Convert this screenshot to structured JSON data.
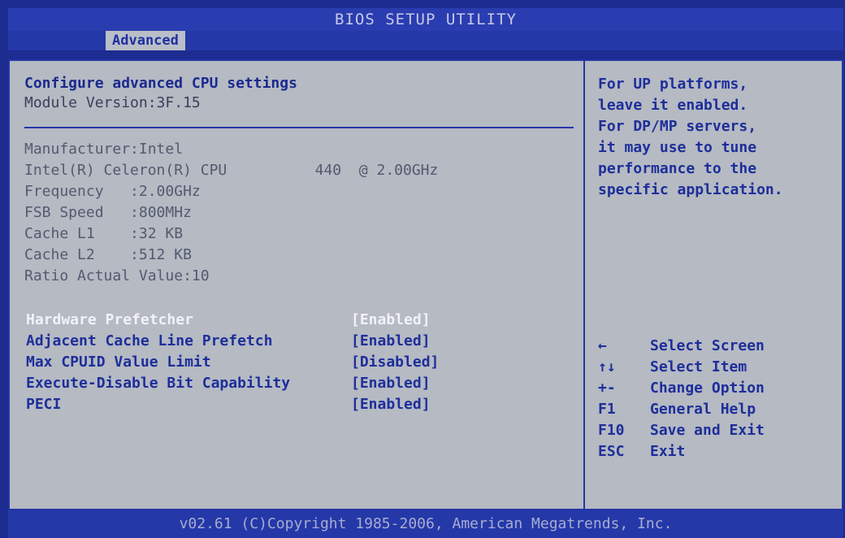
{
  "window": {
    "title": "BIOS SETUP UTILITY"
  },
  "tabs": [
    {
      "label": "Advanced"
    }
  ],
  "main": {
    "heading": "Configure advanced CPU settings",
    "module_version": "Module Version:3F.15",
    "info": [
      "Manufacturer:Intel",
      "Intel(R) Celeron(R) CPU          440  @ 2.00GHz",
      "Frequency   :2.00GHz",
      "FSB Speed   :800MHz",
      "Cache L1    :32 KB",
      "Cache L2    :512 KB",
      "Ratio Actual Value:10"
    ],
    "settings": [
      {
        "name": "Hardware Prefetcher",
        "value": "[Enabled]"
      },
      {
        "name": "Adjacent Cache Line Prefetch",
        "value": "[Enabled]"
      },
      {
        "name": "Max CPUID Value Limit",
        "value": "[Disabled]"
      },
      {
        "name": "Execute-Disable Bit Capability",
        "value": "[Enabled]"
      },
      {
        "name": "PECI",
        "value": "[Enabled]"
      }
    ]
  },
  "help": {
    "lines": [
      "For UP platforms,",
      "leave it enabled.",
      "For DP/MP servers,",
      "it may use to tune",
      "performance to the",
      "specific application."
    ]
  },
  "keys": [
    {
      "key": "←",
      "desc": "Select Screen"
    },
    {
      "key": "↑↓",
      "desc": "Select Item"
    },
    {
      "key": "+-",
      "desc": "Change Option"
    },
    {
      "key": "F1",
      "desc": "General Help"
    },
    {
      "key": "F10",
      "desc": "Save and Exit"
    },
    {
      "key": "ESC",
      "desc": "Exit"
    }
  ],
  "footer": {
    "text": "v02.61 (C)Copyright 1985-2006, American Megatrends, Inc."
  }
}
